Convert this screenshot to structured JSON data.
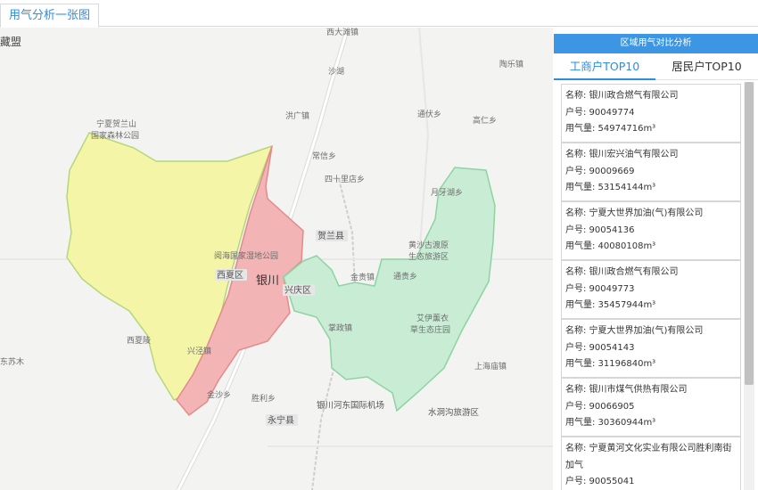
{
  "tab": {
    "label": "用气分析一张图"
  },
  "map": {
    "labels": [
      {
        "name": "corner-left",
        "text": "藏盟"
      },
      {
        "name": "xidatan",
        "text": "西大滩镇"
      },
      {
        "name": "shahu",
        "text": "沙湖"
      },
      {
        "name": "taolezhen",
        "text": "陶乐镇"
      },
      {
        "name": "helan-park-1",
        "text": "宁夏贺兰山"
      },
      {
        "name": "helan-park-2",
        "text": "国家森林公园"
      },
      {
        "name": "honggang",
        "text": "洪广镇"
      },
      {
        "name": "tongfu",
        "text": "通伏乡"
      },
      {
        "name": "gaoren",
        "text": "高仁乡"
      },
      {
        "name": "changxin",
        "text": "常信乡"
      },
      {
        "name": "sishilidian",
        "text": "四十里店乡"
      },
      {
        "name": "yueyahu",
        "text": "月牙湖乡"
      },
      {
        "name": "helanxian",
        "text": "贺兰县"
      },
      {
        "name": "huangsha-1",
        "text": "黄沙古渡原"
      },
      {
        "name": "huangsha-2",
        "text": "生态旅游区"
      },
      {
        "name": "yuehai",
        "text": "阅海国家湿地公园"
      },
      {
        "name": "xixia",
        "text": "西夏区"
      },
      {
        "name": "yinchuan",
        "text": "银川"
      },
      {
        "name": "xingqing",
        "text": "兴庆区"
      },
      {
        "name": "jingui",
        "text": "金贵镇"
      },
      {
        "name": "tonggui",
        "text": "通贵乡"
      },
      {
        "name": "aiyi-1",
        "text": "艾伊薰衣"
      },
      {
        "name": "aiyi-2",
        "text": "草生态庄园"
      },
      {
        "name": "zhangzheng",
        "text": "掌政镇"
      },
      {
        "name": "xixialing",
        "text": "西夏陵"
      },
      {
        "name": "xingjing",
        "text": "兴泾镇"
      },
      {
        "name": "dongsu",
        "text": "东苏木"
      },
      {
        "name": "shanghaimiao",
        "text": "上海庙镇"
      },
      {
        "name": "jinsha",
        "text": "金沙乡"
      },
      {
        "name": "shengli",
        "text": "胜利乡"
      },
      {
        "name": "airport",
        "text": "银川河东国际机场"
      },
      {
        "name": "shuidonggou",
        "text": "水洞沟旅游区"
      },
      {
        "name": "yongning",
        "text": "永宁县"
      }
    ],
    "colors": {
      "yellow": "#f5f5a8",
      "red": "#f2b4b4",
      "green": "#c8ecd4"
    }
  },
  "panel": {
    "title": "区域用气对比分析",
    "tabs": [
      "工商户TOP10",
      "居民户TOP10"
    ],
    "items": [
      {
        "name": "名称: 银川政合燃气有限公司",
        "account": "户号: 90049774",
        "usage": "用气量: 54974716m³"
      },
      {
        "name": "名称: 银川宏兴油气有限公司",
        "account": "户号: 90009669",
        "usage": "用气量: 53154144m³"
      },
      {
        "name": "名称: 宁夏大世界加油(气)有限公司",
        "account": "户号: 90054136",
        "usage": "用气量: 40080108m³"
      },
      {
        "name": "名称: 银川政合燃气有限公司",
        "account": "户号: 90049773",
        "usage": "用气量: 35457944m³"
      },
      {
        "name": "名称: 宁夏大世界加油(气)有限公司",
        "account": "户号: 90054143",
        "usage": "用气量: 31196840m³"
      },
      {
        "name": "名称: 银川市煤气供热有限公司",
        "account": "户号: 90066905",
        "usage": "用气量: 30360944m³"
      },
      {
        "name": "名称: 宁夏黄河文化实业有限公司胜利南街加气",
        "account": "户号: 90055041",
        "usage": ""
      }
    ]
  }
}
